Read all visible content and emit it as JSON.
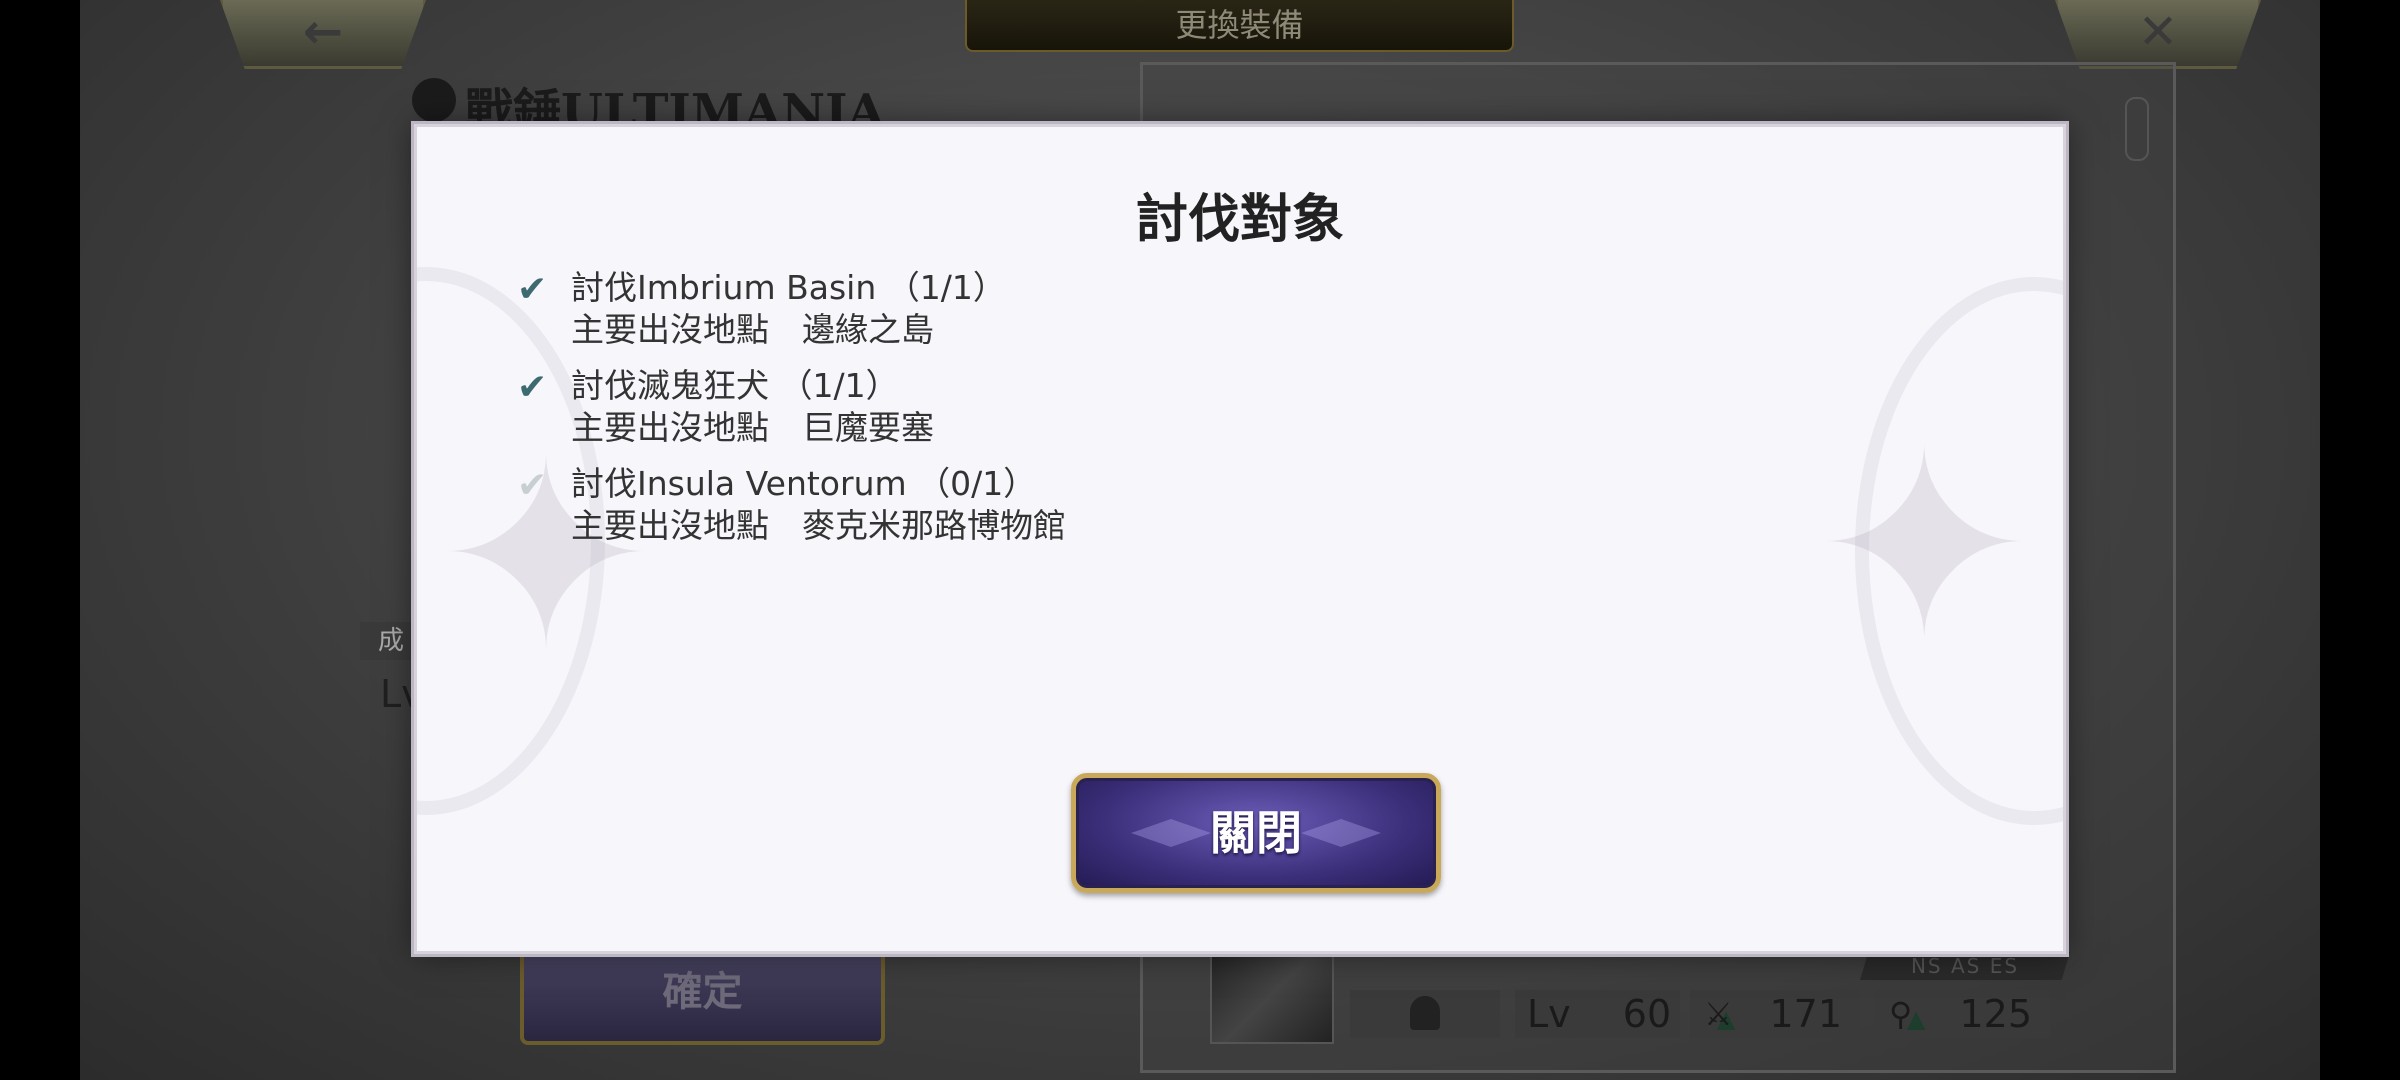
{
  "header": {
    "title": "更換裝備",
    "back_icon": "←",
    "close_icon": "✕"
  },
  "weapon": {
    "name": "戰錘ULTIMANIA",
    "badge": "成",
    "lv_label": "Lv"
  },
  "confirm_label": "確定",
  "stats": {
    "lv_label": "Lv",
    "lv_value": "60",
    "attack": "171",
    "magic": "125",
    "tags": "NS AS ES"
  },
  "modal": {
    "title": "討伐對象",
    "targets": [
      {
        "name": "討伐Imbrium Basin （1/1）",
        "location": "主要出沒地點　邊緣之島",
        "done": true
      },
      {
        "name": "討伐滅鬼狂犬 （1/1）",
        "location": "主要出沒地點　巨魔要塞",
        "done": true
      },
      {
        "name": "討伐Insula Ventorum （0/1）",
        "location": "主要出沒地點　麥克米那路博物館",
        "done": false
      }
    ],
    "close_label": "關閉"
  },
  "colors": {
    "check_done": "#3d6a70",
    "check_pending": "#c7cfd2",
    "button_gold": "#c8a95a",
    "button_purple": "#3b2f7a"
  }
}
